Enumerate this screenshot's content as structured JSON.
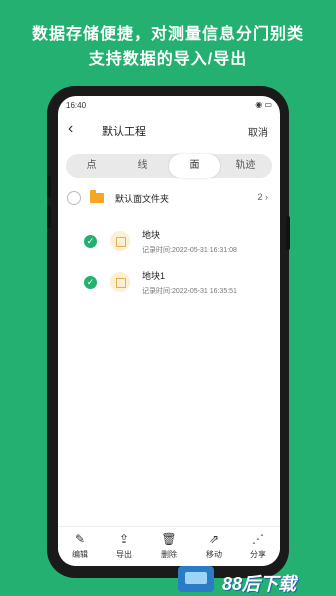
{
  "headline": {
    "line1": "数据存储便捷，对测量信息分门别类",
    "line2": "支持数据的导入/导出"
  },
  "status_bar": {
    "time": "16:40",
    "right_icons": "◉ ▭"
  },
  "header": {
    "back_icon": "‹",
    "title": "默认工程",
    "cancel_label": "取消"
  },
  "tabs": [
    {
      "label": "点"
    },
    {
      "label": "线"
    },
    {
      "label": "面",
      "active": true
    },
    {
      "label": "轨迹"
    }
  ],
  "folder": {
    "name": "默认面文件夹",
    "count": "2",
    "chevron": "›"
  },
  "items": [
    {
      "name": "地块",
      "time": "记录时间:2022-05-31 16:31:08",
      "checked": true
    },
    {
      "name": "地块1",
      "time": "记录时间:2022-05-31 16:35:51",
      "checked": true
    }
  ],
  "toolbar": [
    {
      "icon": "edit-icon",
      "glyph": "✎",
      "label": "编辑"
    },
    {
      "icon": "export-icon",
      "glyph": "⇪",
      "label": "导出"
    },
    {
      "icon": "delete-icon",
      "glyph": "🗑",
      "label": "删除"
    },
    {
      "icon": "move-icon",
      "glyph": "⇗",
      "label": "移动"
    },
    {
      "icon": "share-icon",
      "glyph": "⋰",
      "label": "分享"
    }
  ],
  "watermark": {
    "text": "88后下载"
  },
  "colors": {
    "accent": "#23b071",
    "folder": "#f5a623"
  }
}
